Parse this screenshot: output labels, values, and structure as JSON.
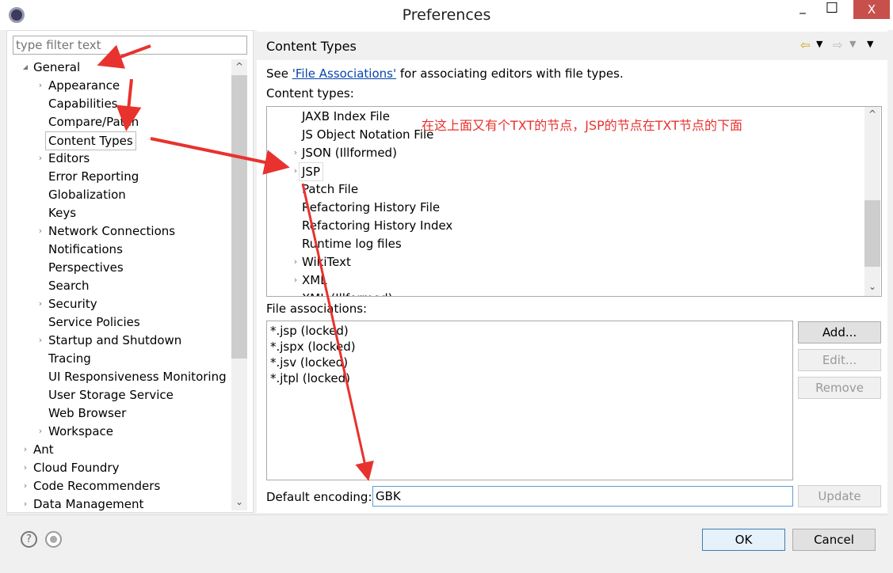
{
  "window": {
    "title": "Preferences",
    "close": "X",
    "minimize": "_",
    "maximize": "☐"
  },
  "left": {
    "filter_placeholder": "type filter text",
    "tree": [
      {
        "label": "General",
        "level": 0,
        "twisty": "expanded"
      },
      {
        "label": "Appearance",
        "level": 1,
        "twisty": "collapsed"
      },
      {
        "label": "Capabilities",
        "level": 1,
        "twisty": ""
      },
      {
        "label": "Compare/Patch",
        "level": 1,
        "twisty": ""
      },
      {
        "label": "Content Types",
        "level": 1,
        "twisty": "",
        "selected": true
      },
      {
        "label": "Editors",
        "level": 1,
        "twisty": "collapsed"
      },
      {
        "label": "Error Reporting",
        "level": 1,
        "twisty": ""
      },
      {
        "label": "Globalization",
        "level": 1,
        "twisty": ""
      },
      {
        "label": "Keys",
        "level": 1,
        "twisty": ""
      },
      {
        "label": "Network Connections",
        "level": 1,
        "twisty": "collapsed"
      },
      {
        "label": "Notifications",
        "level": 1,
        "twisty": ""
      },
      {
        "label": "Perspectives",
        "level": 1,
        "twisty": ""
      },
      {
        "label": "Search",
        "level": 1,
        "twisty": ""
      },
      {
        "label": "Security",
        "level": 1,
        "twisty": "collapsed"
      },
      {
        "label": "Service Policies",
        "level": 1,
        "twisty": ""
      },
      {
        "label": "Startup and Shutdown",
        "level": 1,
        "twisty": "collapsed"
      },
      {
        "label": "Tracing",
        "level": 1,
        "twisty": ""
      },
      {
        "label": "UI Responsiveness Monitoring",
        "level": 1,
        "twisty": ""
      },
      {
        "label": "User Storage Service",
        "level": 1,
        "twisty": ""
      },
      {
        "label": "Web Browser",
        "level": 1,
        "twisty": ""
      },
      {
        "label": "Workspace",
        "level": 1,
        "twisty": "collapsed"
      },
      {
        "label": "Ant",
        "level": 0,
        "twisty": "collapsed"
      },
      {
        "label": "Cloud Foundry",
        "level": 0,
        "twisty": "collapsed"
      },
      {
        "label": "Code Recommenders",
        "level": 0,
        "twisty": "collapsed"
      },
      {
        "label": "Data Management",
        "level": 0,
        "twisty": "collapsed"
      }
    ]
  },
  "page": {
    "title": "Content Types",
    "see_prefix": "See ",
    "link": "'File Associations'",
    "see_suffix": " for associating editors with file types.",
    "content_types_label": "Content types:",
    "content_types": [
      {
        "label": "JAXB Index File",
        "twisty": ""
      },
      {
        "label": "JS Object Notation File",
        "twisty": ""
      },
      {
        "label": "JSON (Illformed)",
        "twisty": "collapsed"
      },
      {
        "label": "JSP",
        "twisty": "collapsed",
        "selected": true
      },
      {
        "label": "Patch File",
        "twisty": ""
      },
      {
        "label": "Refactoring History File",
        "twisty": ""
      },
      {
        "label": "Refactoring History Index",
        "twisty": ""
      },
      {
        "label": "Runtime log files",
        "twisty": ""
      },
      {
        "label": "WikiText",
        "twisty": "collapsed"
      },
      {
        "label": "XML",
        "twisty": "collapsed"
      },
      {
        "label": "XML (Illformed)",
        "twisty": ""
      }
    ],
    "file_assoc_label": "File associations:",
    "file_assocs": [
      "*.jsp (locked)",
      "*.jspx (locked)",
      "*.jsv (locked)",
      "*.jtpl (locked)"
    ],
    "add": "Add...",
    "edit": "Edit...",
    "remove": "Remove",
    "encoding_label": "Default encoding:",
    "encoding_value": "GBK",
    "update": "Update"
  },
  "annotation": "在这上面又有个TXT的节点，JSP的节点在TXT节点的下面",
  "footer": {
    "ok": "OK",
    "cancel": "Cancel"
  },
  "colors": {
    "annotation": "#e8322e",
    "close": "#c7504c",
    "link": "#0645ad"
  }
}
